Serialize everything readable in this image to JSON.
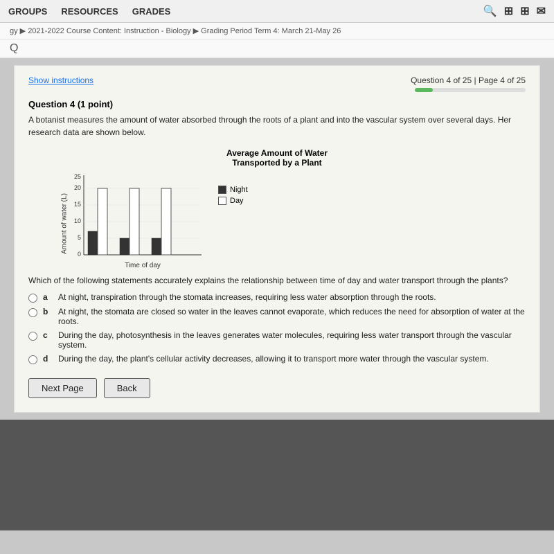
{
  "nav": {
    "groups": "GROUPS",
    "resources": "RESOURCES",
    "grades": "GRADES"
  },
  "breadcrumb": {
    "text": "gy ▶ 2021-2022 Course Content: Instruction - Biology ▶ Grading Period Term 4: March 21-May 26"
  },
  "header": {
    "show_instructions": "Show instructions",
    "question_info": "Question 4 of 25 | Page 4 of 25",
    "progress_percent": 16
  },
  "question": {
    "title": "Question 4",
    "points": "(1 point)",
    "text": "A botanist measures the amount of water absorbed through the roots of a plant and into the vascular system over several days. Her research data are shown below.",
    "chart_title_line1": "Average Amount of Water",
    "chart_title_line2": "Transported by a Plant",
    "y_axis_label": "Amount of water (L)",
    "x_axis_label": "Time of day",
    "legend_night": "Night",
    "legend_day": "Day",
    "prompt": "Which of the following statements accurately explains the relationship between time of day and water transport through the plants?",
    "options": [
      {
        "label": "a",
        "text": "At night, transpiration through the stomata increases, requiring less water absorption through the roots."
      },
      {
        "label": "b",
        "text": "At night, the stomata are closed so water in the leaves cannot evaporate, which reduces the need for absorption of water at the roots."
      },
      {
        "label": "c",
        "text": "During the day, photosynthesis in the leaves generates water molecules, requiring less water transport through the vascular system."
      },
      {
        "label": "d",
        "text": "During the day, the plant's cellular activity decreases, allowing it to transport more water through the vascular system."
      }
    ]
  },
  "buttons": {
    "next_page": "Next Page",
    "back": "Back"
  }
}
